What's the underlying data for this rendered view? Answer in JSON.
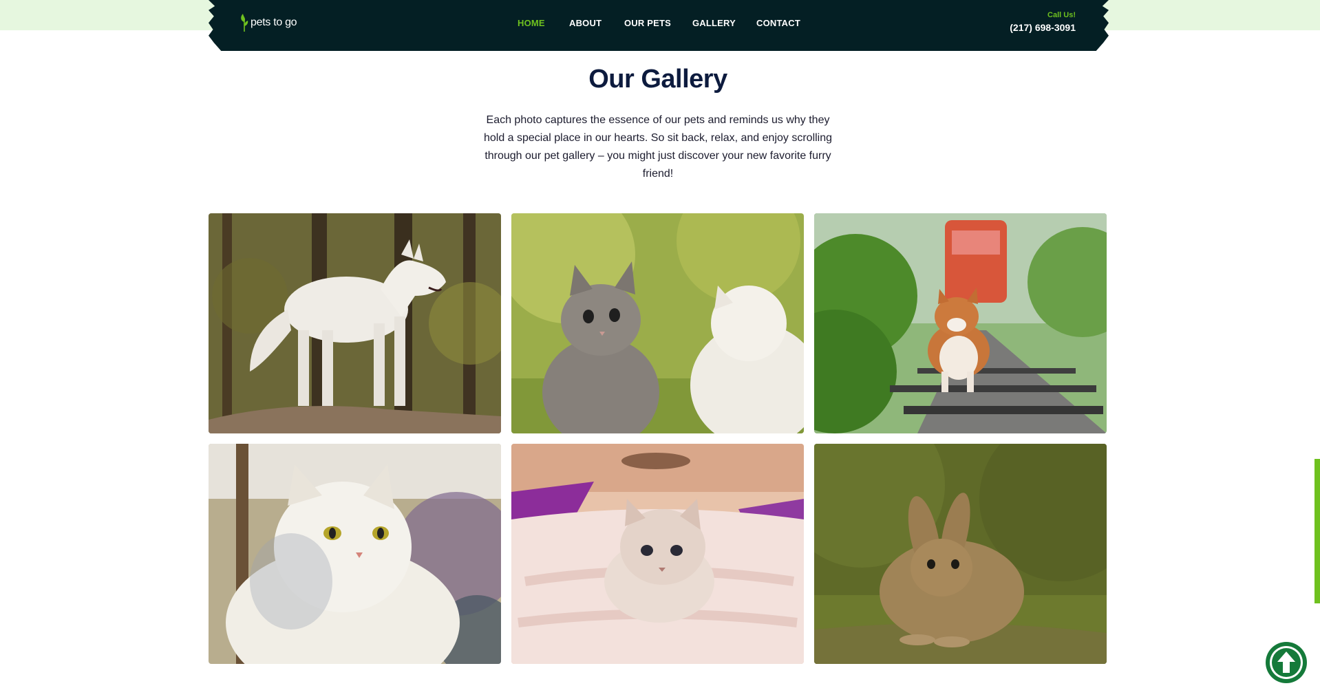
{
  "brand": {
    "name": "pets to go",
    "logo_icon": "leaf-icon"
  },
  "nav": {
    "items": [
      {
        "label": "HOME",
        "active": true
      },
      {
        "label": "ABOUT",
        "active": false
      },
      {
        "label": "OUR PETS",
        "active": false
      },
      {
        "label": "GALLERY",
        "active": false
      },
      {
        "label": "CONTACT",
        "active": false
      }
    ]
  },
  "call": {
    "label": "Call Us!",
    "phone": "(217) 698-3091"
  },
  "gallery": {
    "title": "Our Gallery",
    "intro": "Each photo captures the essence of our pets and reminds us why they hold a special place in our hearts. So sit back, relax, and enjoy scrolling through our pet gallery – you might just discover your new favorite furry friend!",
    "photos": [
      {
        "subject": "white wolf dog on rock in forest"
      },
      {
        "subject": "grey kitten looking up with white cat"
      },
      {
        "subject": "corgi running on railway track"
      },
      {
        "subject": "white persian cat"
      },
      {
        "subject": "fluffy kitten on pink blanket"
      },
      {
        "subject": "brown rabbit on grass"
      }
    ]
  },
  "back_to_top": {
    "icon": "arrow-up-icon"
  },
  "colors": {
    "nav_bg": "#041f24",
    "accent_green": "#6fc11f",
    "title_navy": "#0d1b3e",
    "top_band": "#e6f7df",
    "back_to_top_bg": "#157a3a"
  }
}
